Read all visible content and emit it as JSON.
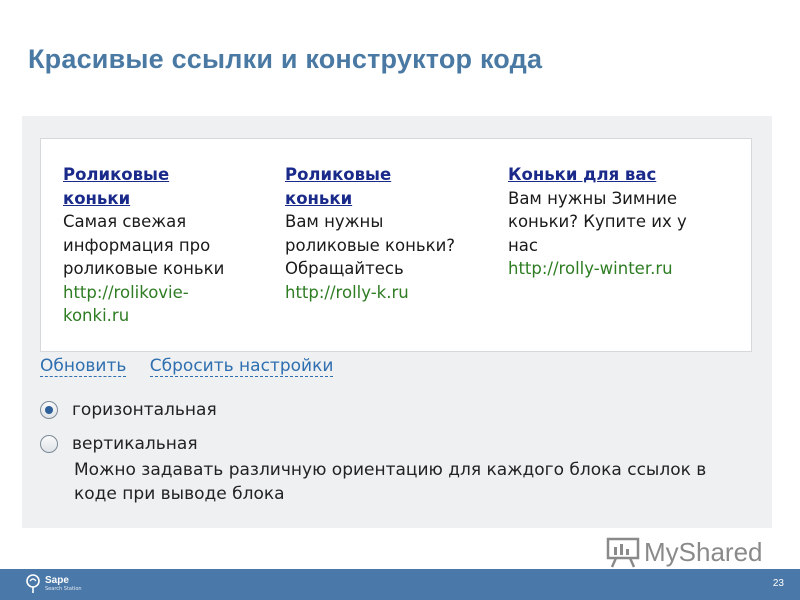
{
  "slide": {
    "title": "Красивые ссылки и конструктор кода",
    "page_number": "23"
  },
  "ads": [
    {
      "title_line1": "Роликовые",
      "title_line2": "коньки",
      "text_lines": [
        "Самая свежая",
        "информация про",
        "роликовые коньки"
      ],
      "url_lines": [
        "http://rolikovie-",
        "konki.ru"
      ]
    },
    {
      "title_line1": "Роликовые",
      "title_line2": "коньки",
      "text_lines": [
        "Вам нужны",
        "роликовые коньки?",
        "Обращайтесь"
      ],
      "url_lines": [
        "http://rolly-k.ru"
      ]
    },
    {
      "title_line1": "Коньки для вас",
      "text_lines": [
        "Вам нужны Зимние",
        "коньки? Купите их у",
        "нас"
      ],
      "url_lines": [
        "http://rolly-winter.ru"
      ]
    }
  ],
  "actions": {
    "refresh_label": "Обновить",
    "reset_label": "Сбросить настройки"
  },
  "orientation": {
    "selected": "horizontal",
    "horizontal_label": "горизонтальная",
    "vertical_label": "вертикальная",
    "hint": "Можно задавать различную ориентацию для каждого блока ссылок в коде при выводе блока"
  },
  "watermark": {
    "text": "MyShared",
    "icon": "presentation-board-icon"
  },
  "footer": {
    "brand": "Sape",
    "tagline": "Search Station",
    "color": "#4a78a8"
  },
  "colors": {
    "title": "#4a7aa3",
    "link_title": "#1a2a8a",
    "url": "#2e7d23",
    "action_link": "#2f6fb0"
  }
}
